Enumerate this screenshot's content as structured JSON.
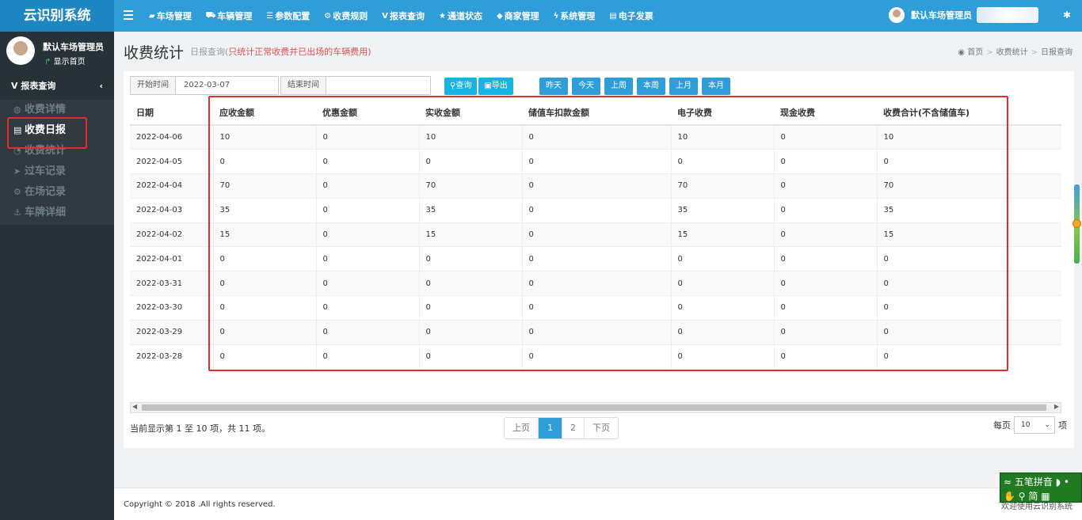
{
  "app": {
    "title": "云识别系统"
  },
  "nav": [
    {
      "icon": "car-icon",
      "label": "车场管理"
    },
    {
      "icon": "car-icon",
      "label": "车辆管理"
    },
    {
      "icon": "sliders-icon",
      "label": "参数配置"
    },
    {
      "icon": "gears-icon",
      "label": "收费规则"
    },
    {
      "icon": "vine-icon",
      "label": "报表查询"
    },
    {
      "icon": "star-icon",
      "label": "通道状态"
    },
    {
      "icon": "tag-icon",
      "label": "商家管理"
    },
    {
      "icon": "bolt-icon",
      "label": "系统管理"
    },
    {
      "icon": "card-icon",
      "label": "电子发票"
    }
  ],
  "user": {
    "name": "默认车场管理员"
  },
  "sidebar": {
    "profile_name": "默认车场管理员",
    "profile_link": "显示首页",
    "section": "报表查询",
    "items": [
      {
        "icon": "globe-icon",
        "label": "收费详情"
      },
      {
        "icon": "list-icon",
        "label": "收费日报"
      },
      {
        "icon": "pie-icon",
        "label": "收费统计"
      },
      {
        "icon": "plane-icon",
        "label": "过车记录"
      },
      {
        "icon": "gears-icon",
        "label": "在场记录"
      },
      {
        "icon": "anchor-icon",
        "label": "车牌详细"
      }
    ]
  },
  "page": {
    "title": "收费统计",
    "subtitle_a": "日报查询(",
    "subtitle_b": "只统计正常收费并已出场的车辆费用",
    "subtitle_c": ")",
    "breadcrumb": [
      "首页",
      "收费统计",
      "日报查询"
    ]
  },
  "filter": {
    "start_label": "开始时间",
    "start_value": "2022-03-07",
    "end_label": "结束时间",
    "end_value": "",
    "search": "查询",
    "export": "导出",
    "quick": [
      "昨天",
      "今天",
      "上周",
      "本周",
      "上月",
      "本月"
    ]
  },
  "table": {
    "headers": [
      "日期",
      "应收金额",
      "优惠金额",
      "实收金额",
      "储值车扣款金额",
      "电子收费",
      "现金收费",
      "收费合计(不含储值车)"
    ],
    "rows": [
      [
        "2022-04-06",
        "10",
        "0",
        "10",
        "0",
        "10",
        "0",
        "10"
      ],
      [
        "2022-04-05",
        "0",
        "0",
        "0",
        "0",
        "0",
        "0",
        "0"
      ],
      [
        "2022-04-04",
        "70",
        "0",
        "70",
        "0",
        "70",
        "0",
        "70"
      ],
      [
        "2022-04-03",
        "35",
        "0",
        "35",
        "0",
        "35",
        "0",
        "35"
      ],
      [
        "2022-04-02",
        "15",
        "0",
        "15",
        "0",
        "15",
        "0",
        "15"
      ],
      [
        "2022-04-01",
        "0",
        "0",
        "0",
        "0",
        "0",
        "0",
        "0"
      ],
      [
        "2022-03-31",
        "0",
        "0",
        "0",
        "0",
        "0",
        "0",
        "0"
      ],
      [
        "2022-03-30",
        "0",
        "0",
        "0",
        "0",
        "0",
        "0",
        "0"
      ],
      [
        "2022-03-29",
        "0",
        "0",
        "0",
        "0",
        "0",
        "0",
        "0"
      ],
      [
        "2022-03-28",
        "0",
        "0",
        "0",
        "0",
        "0",
        "0",
        "0"
      ]
    ]
  },
  "pagination": {
    "info": "当前显示第 1 至 10 项，共 11 项。",
    "prev": "上页",
    "pages": [
      "1",
      "2"
    ],
    "next": "下页",
    "per_page_label": "每页",
    "per_page_value": "10",
    "per_page_suffix": "项"
  },
  "footer": {
    "copyright": "Copyright © 2018 .All rights reserved.",
    "welcome": "欢迎使用云识别系统"
  },
  "ime": {
    "row1": "五笔拼音",
    "row2": "简"
  },
  "colors": {
    "accent": "#2f9ed8",
    "sidebar": "#263238",
    "highlight": "#e42c2c"
  }
}
